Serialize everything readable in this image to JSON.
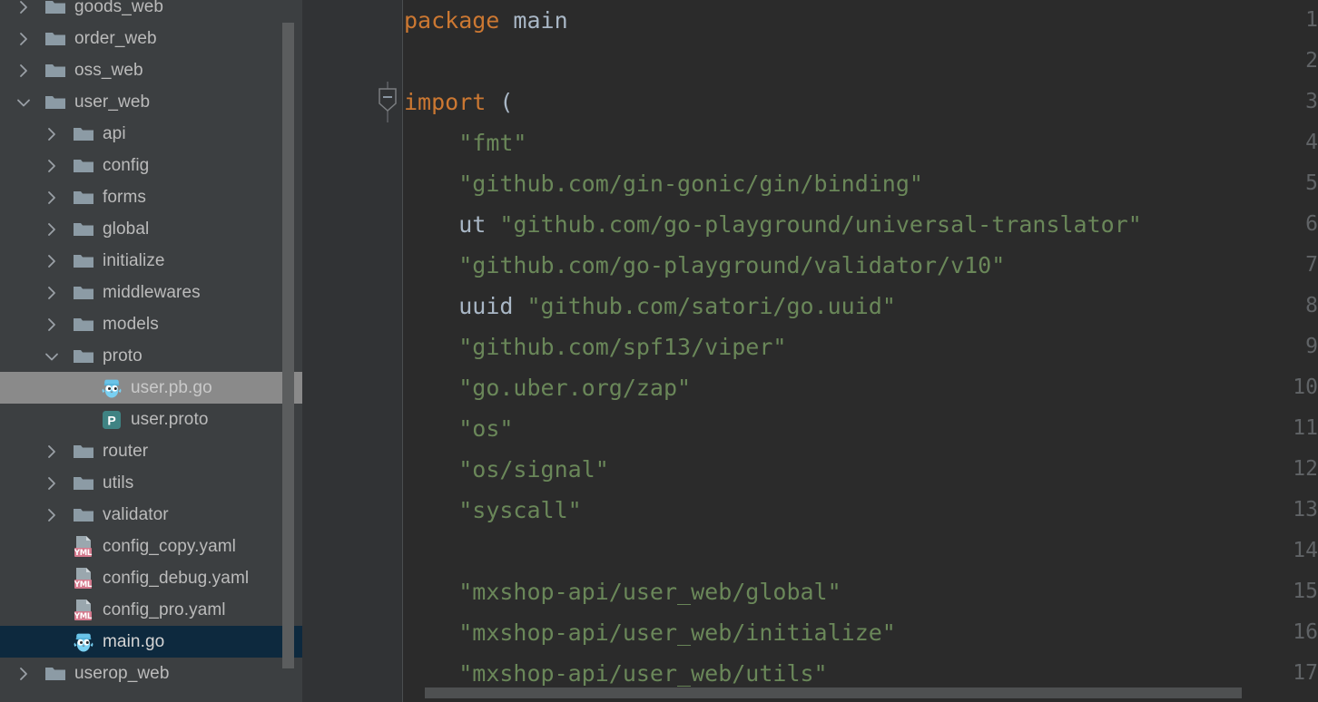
{
  "sidebar": {
    "scrollbar": {
      "name": "project-tree-scrollbar"
    },
    "items": [
      {
        "label": "goods_web",
        "type": "folder",
        "state": "collapsed",
        "depth": 1,
        "icon": "folder-icon",
        "selected": "none"
      },
      {
        "label": "order_web",
        "type": "folder",
        "state": "collapsed",
        "depth": 1,
        "icon": "folder-icon",
        "selected": "none"
      },
      {
        "label": "oss_web",
        "type": "folder",
        "state": "collapsed",
        "depth": 1,
        "icon": "folder-icon",
        "selected": "none"
      },
      {
        "label": "user_web",
        "type": "folder",
        "state": "expanded",
        "depth": 1,
        "icon": "folder-icon",
        "selected": "none"
      },
      {
        "label": "api",
        "type": "folder",
        "state": "collapsed",
        "depth": 2,
        "icon": "folder-icon",
        "selected": "none"
      },
      {
        "label": "config",
        "type": "folder",
        "state": "collapsed",
        "depth": 2,
        "icon": "folder-icon",
        "selected": "none"
      },
      {
        "label": "forms",
        "type": "folder",
        "state": "collapsed",
        "depth": 2,
        "icon": "folder-icon",
        "selected": "none"
      },
      {
        "label": "global",
        "type": "folder",
        "state": "collapsed",
        "depth": 2,
        "icon": "folder-icon",
        "selected": "none"
      },
      {
        "label": "initialize",
        "type": "folder",
        "state": "collapsed",
        "depth": 2,
        "icon": "folder-icon",
        "selected": "none"
      },
      {
        "label": "middlewares",
        "type": "folder",
        "state": "collapsed",
        "depth": 2,
        "icon": "folder-icon",
        "selected": "none"
      },
      {
        "label": "models",
        "type": "folder",
        "state": "collapsed",
        "depth": 2,
        "icon": "folder-icon",
        "selected": "none"
      },
      {
        "label": "proto",
        "type": "folder",
        "state": "expanded",
        "depth": 2,
        "icon": "folder-icon",
        "selected": "none"
      },
      {
        "label": "user.pb.go",
        "type": "file",
        "state": "leaf",
        "depth": 3,
        "icon": "go-file-icon",
        "selected": "inactive"
      },
      {
        "label": "user.proto",
        "type": "file",
        "state": "leaf",
        "depth": 3,
        "icon": "proto-file-icon",
        "selected": "none"
      },
      {
        "label": "router",
        "type": "folder",
        "state": "collapsed",
        "depth": 2,
        "icon": "folder-icon",
        "selected": "none"
      },
      {
        "label": "utils",
        "type": "folder",
        "state": "collapsed",
        "depth": 2,
        "icon": "folder-icon",
        "selected": "none"
      },
      {
        "label": "validator",
        "type": "folder",
        "state": "collapsed",
        "depth": 2,
        "icon": "folder-icon",
        "selected": "none"
      },
      {
        "label": "config_copy.yaml",
        "type": "file",
        "state": "leaf",
        "depth": 2,
        "icon": "yml-file-icon",
        "selected": "none"
      },
      {
        "label": "config_debug.yaml",
        "type": "file",
        "state": "leaf",
        "depth": 2,
        "icon": "yml-file-icon",
        "selected": "none"
      },
      {
        "label": "config_pro.yaml",
        "type": "file",
        "state": "leaf",
        "depth": 2,
        "icon": "yml-file-icon",
        "selected": "none"
      },
      {
        "label": "main.go",
        "type": "file",
        "state": "leaf",
        "depth": 2,
        "icon": "go-file-icon",
        "selected": "active"
      },
      {
        "label": "userop_web",
        "type": "folder",
        "state": "collapsed",
        "depth": 1,
        "icon": "folder-icon",
        "selected": "none"
      }
    ]
  },
  "editor": {
    "language": "go",
    "fold_marker_line": 3,
    "line_numbers": [
      1,
      2,
      3,
      4,
      5,
      6,
      7,
      8,
      9,
      10,
      11,
      12,
      13,
      14,
      15,
      16,
      17
    ],
    "lines": [
      {
        "n": 1,
        "tokens": [
          {
            "t": "package",
            "c": "kw"
          },
          {
            "t": " ",
            "c": "punct"
          },
          {
            "t": "main",
            "c": "id"
          }
        ]
      },
      {
        "n": 2,
        "tokens": []
      },
      {
        "n": 3,
        "tokens": [
          {
            "t": "import",
            "c": "kw"
          },
          {
            "t": " ",
            "c": "punct"
          },
          {
            "t": "(",
            "c": "punct"
          }
        ]
      },
      {
        "n": 4,
        "tokens": [
          {
            "t": "    ",
            "c": "punct"
          },
          {
            "t": "\"fmt\"",
            "c": "str"
          }
        ]
      },
      {
        "n": 5,
        "tokens": [
          {
            "t": "    ",
            "c": "punct"
          },
          {
            "t": "\"github.com/gin-gonic/gin/binding\"",
            "c": "str"
          }
        ]
      },
      {
        "n": 6,
        "tokens": [
          {
            "t": "    ",
            "c": "punct"
          },
          {
            "t": "ut",
            "c": "id"
          },
          {
            "t": " ",
            "c": "punct"
          },
          {
            "t": "\"github.com/go-playground/universal-translator\"",
            "c": "str"
          }
        ]
      },
      {
        "n": 7,
        "tokens": [
          {
            "t": "    ",
            "c": "punct"
          },
          {
            "t": "\"github.com/go-playground/validator/v10\"",
            "c": "str"
          }
        ]
      },
      {
        "n": 8,
        "tokens": [
          {
            "t": "    ",
            "c": "punct"
          },
          {
            "t": "uuid",
            "c": "id"
          },
          {
            "t": " ",
            "c": "punct"
          },
          {
            "t": "\"github.com/satori/go.uuid\"",
            "c": "str"
          }
        ]
      },
      {
        "n": 9,
        "tokens": [
          {
            "t": "    ",
            "c": "punct"
          },
          {
            "t": "\"github.com/spf13/viper\"",
            "c": "str"
          }
        ]
      },
      {
        "n": 10,
        "tokens": [
          {
            "t": "    ",
            "c": "punct"
          },
          {
            "t": "\"go.uber.org/zap\"",
            "c": "str"
          }
        ]
      },
      {
        "n": 11,
        "tokens": [
          {
            "t": "    ",
            "c": "punct"
          },
          {
            "t": "\"os\"",
            "c": "str"
          }
        ]
      },
      {
        "n": 12,
        "tokens": [
          {
            "t": "    ",
            "c": "punct"
          },
          {
            "t": "\"os/signal\"",
            "c": "str"
          }
        ]
      },
      {
        "n": 13,
        "tokens": [
          {
            "t": "    ",
            "c": "punct"
          },
          {
            "t": "\"syscall\"",
            "c": "str"
          }
        ]
      },
      {
        "n": 14,
        "tokens": []
      },
      {
        "n": 15,
        "tokens": [
          {
            "t": "    ",
            "c": "punct"
          },
          {
            "t": "\"mxshop-api/user_web/global\"",
            "c": "str"
          }
        ]
      },
      {
        "n": 16,
        "tokens": [
          {
            "t": "    ",
            "c": "punct"
          },
          {
            "t": "\"mxshop-api/user_web/initialize\"",
            "c": "str"
          }
        ]
      },
      {
        "n": 17,
        "tokens": [
          {
            "t": "    ",
            "c": "punct"
          },
          {
            "t": "\"mxshop-api/user_web/utils\"",
            "c": "str"
          }
        ]
      }
    ]
  },
  "colors": {
    "sidebar_bg": "#3c3f41",
    "editor_bg": "#2b2b2b",
    "gutter_bg": "#313335",
    "keyword": "#cc7832",
    "string": "#6a8759",
    "identifier": "#a9b7c6",
    "line_number": "#606366",
    "selection_active": "#0d293e",
    "selection_inactive": "#8a8a8a",
    "scrollbar": "#5b5d5e",
    "go_icon": "#7fd3f7",
    "proto_icon": "#3d7c7c",
    "yml_icon": "#d4798d"
  }
}
